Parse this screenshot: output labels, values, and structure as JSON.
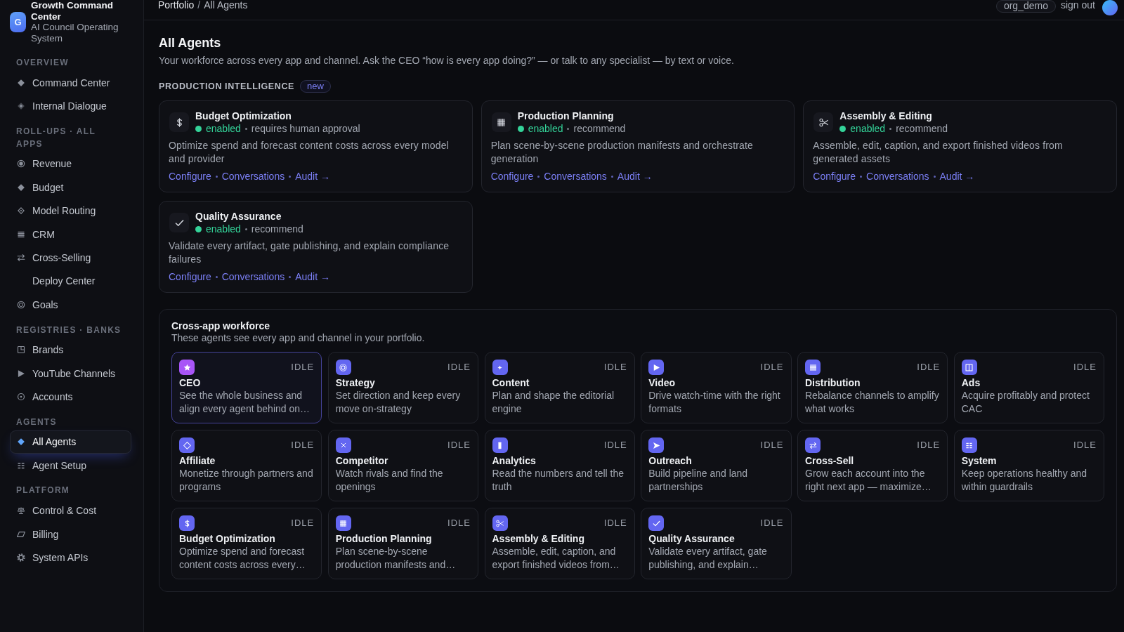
{
  "sidebar": {
    "brand": {
      "logo_letter": "G",
      "title": "Growth Command Center",
      "subtitle": "AI Council Operating System"
    },
    "sections": [
      {
        "heading": "OVERVIEW",
        "items": [
          {
            "label": "Command Center",
            "selected": false
          },
          {
            "label": "Internal Dialogue",
            "selected": false
          }
        ]
      },
      {
        "heading": "ROLL-UPS · ALL APPS",
        "items": [
          {
            "label": "Revenue",
            "selected": false
          },
          {
            "label": "Budget",
            "selected": false
          },
          {
            "label": "Model Routing",
            "selected": false
          },
          {
            "label": "CRM",
            "selected": false
          },
          {
            "label": "Cross-Selling",
            "selected": false
          },
          {
            "label": "Deploy Center",
            "selected": false
          },
          {
            "label": "Goals",
            "selected": false
          }
        ]
      },
      {
        "heading": "REGISTRIES · BANKS",
        "items": [
          {
            "label": "Brands",
            "selected": false
          },
          {
            "label": "YouTube Channels",
            "selected": false
          },
          {
            "label": "Accounts",
            "selected": false
          }
        ]
      },
      {
        "heading": "AGENTS",
        "items": [
          {
            "label": "All Agents",
            "selected": true
          },
          {
            "label": "Agent Setup",
            "selected": false
          }
        ]
      },
      {
        "heading": "PLATFORM",
        "items": [
          {
            "label": "Control & Cost",
            "selected": false
          },
          {
            "label": "Billing",
            "selected": false
          },
          {
            "label": "System APIs",
            "selected": false
          }
        ]
      }
    ]
  },
  "header": {
    "breadcrumb": {
      "parent": "Portfolio",
      "separator": "/",
      "current": "All Agents"
    },
    "org": "org_demo",
    "sign_out": "sign out"
  },
  "page": {
    "title": "All Agents",
    "description": "Your workforce across every app and channel. Ask the CEO “how is every app doing?” — or talk to any specialist — by text or voice."
  },
  "production_intelligence": {
    "heading": "PRODUCTION INTELLIGENCE",
    "badge": "new",
    "cards": [
      {
        "title": "Budget Optimization",
        "status": "enabled",
        "mode": "requires human approval",
        "description": "Optimize spend and forecast content costs across every model and provider",
        "links": [
          "Configure",
          "Conversations",
          "Audit →"
        ]
      },
      {
        "title": "Production Planning",
        "status": "enabled",
        "mode": "recommend",
        "description": "Plan scene-by-scene production manifests and orchestrate generation",
        "links": [
          "Configure",
          "Conversations",
          "Audit →"
        ]
      },
      {
        "title": "Assembly & Editing",
        "status": "enabled",
        "mode": "recommend",
        "description": "Assemble, edit, caption, and export finished videos from generated assets",
        "links": [
          "Configure",
          "Conversations",
          "Audit →"
        ]
      },
      {
        "title": "Quality Assurance",
        "status": "enabled",
        "mode": "recommend",
        "description": "Validate every artifact, gate publishing, and explain compliance failures",
        "links": [
          "Configure",
          "Conversations",
          "Audit →"
        ]
      }
    ]
  },
  "workforce": {
    "title": "Cross-app workforce",
    "subtitle": "These agents see every app and channel in your portfolio.",
    "agents": [
      {
        "name": "CEO",
        "status": "IDLE",
        "description": "See the whole business and align every agent behind on…",
        "color": "#a855f7",
        "selected": true
      },
      {
        "name": "Strategy",
        "status": "IDLE",
        "description": "Set direction and keep every move on-strategy",
        "color": "#6366f1",
        "selected": false
      },
      {
        "name": "Content",
        "status": "IDLE",
        "description": "Plan and shape the editorial engine",
        "color": "#6366f1",
        "selected": false
      },
      {
        "name": "Video",
        "status": "IDLE",
        "description": "Drive watch-time with the right formats",
        "color": "#6366f1",
        "selected": false
      },
      {
        "name": "Distribution",
        "status": "IDLE",
        "description": "Rebalance channels to amplify what works",
        "color": "#6366f1",
        "selected": false
      },
      {
        "name": "Ads",
        "status": "IDLE",
        "description": "Acquire profitably and protect CAC",
        "color": "#6366f1",
        "selected": false
      },
      {
        "name": "Affiliate",
        "status": "IDLE",
        "description": "Monetize through partners and programs",
        "color": "#6366f1",
        "selected": false
      },
      {
        "name": "Competitor",
        "status": "IDLE",
        "description": "Watch rivals and find the openings",
        "color": "#6366f1",
        "selected": false
      },
      {
        "name": "Analytics",
        "status": "IDLE",
        "description": "Read the numbers and tell the truth",
        "color": "#6366f1",
        "selected": false
      },
      {
        "name": "Outreach",
        "status": "IDLE",
        "description": "Build pipeline and land partnerships",
        "color": "#6366f1",
        "selected": false
      },
      {
        "name": "Cross-Sell",
        "status": "IDLE",
        "description": "Grow each account into the right next app — maximize…",
        "color": "#6366f1",
        "selected": false
      },
      {
        "name": "System",
        "status": "IDLE",
        "description": "Keep operations healthy and within guardrails",
        "color": "#6366f1",
        "selected": false
      },
      {
        "name": "Budget Optimization",
        "status": "IDLE",
        "description": "Optimize spend and forecast content costs across every…",
        "color": "#6366f1",
        "selected": false
      },
      {
        "name": "Production Planning",
        "status": "IDLE",
        "description": "Plan scene-by-scene production manifests and…",
        "color": "#6366f1",
        "selected": false
      },
      {
        "name": "Assembly & Editing",
        "status": "IDLE",
        "description": "Assemble, edit, caption, and export finished videos from…",
        "color": "#6366f1",
        "selected": false
      },
      {
        "name": "Quality Assurance",
        "status": "IDLE",
        "description": "Validate every artifact, gate publishing, and explain…",
        "color": "#6366f1",
        "selected": false
      }
    ]
  }
}
